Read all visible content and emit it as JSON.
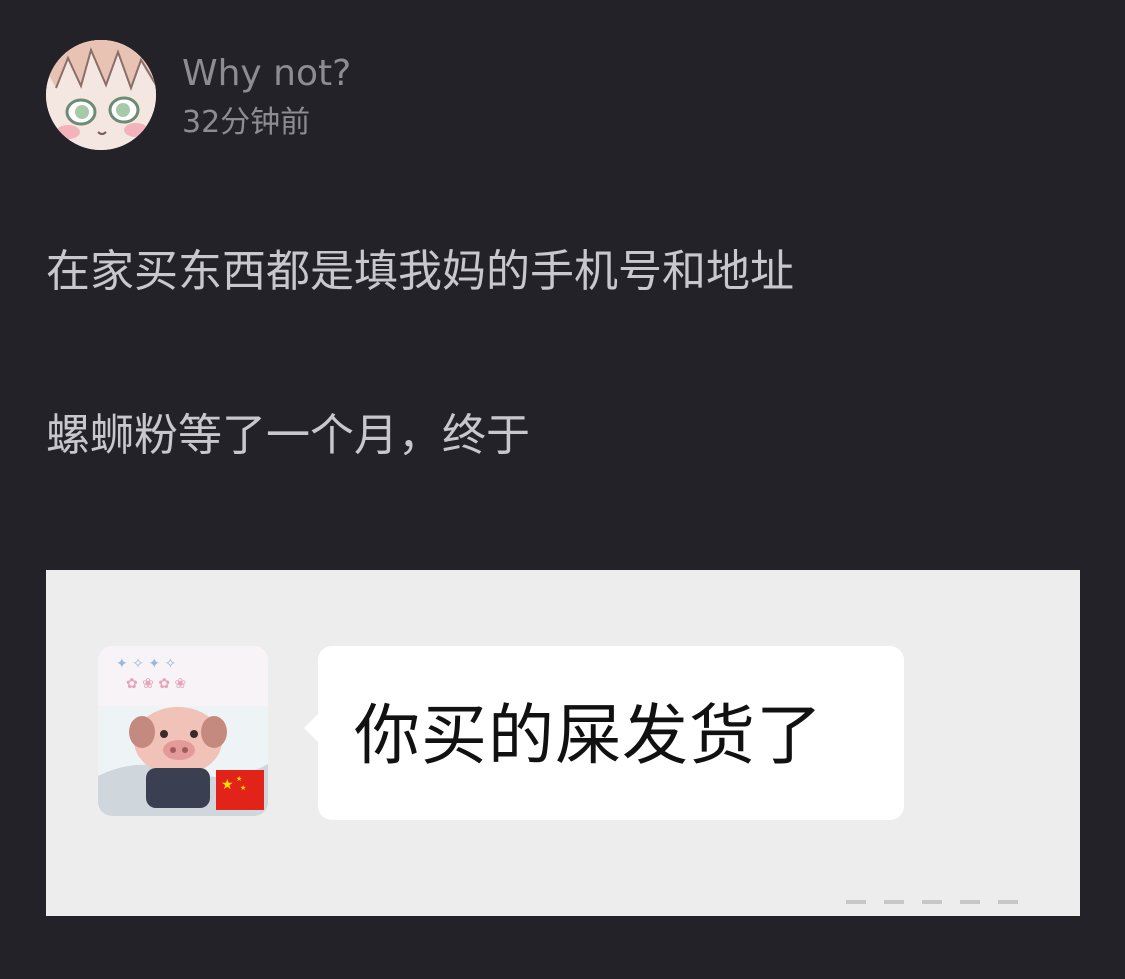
{
  "post": {
    "author": {
      "name": "Why not?",
      "time_ago": "32分钟前"
    },
    "text_lines": [
      "在家买东西都是填我妈的手机号和地址",
      "螺蛳粉等了一个月，终于"
    ],
    "image": {
      "message_text": "你买的屎发货了",
      "flag_icon": "china-flag-icon"
    }
  },
  "colors": {
    "background": "#232229",
    "meta_text": "#8d8c93",
    "body_text": "#c8c7cc",
    "image_background": "#ededed",
    "bubble": "#ffffff"
  }
}
